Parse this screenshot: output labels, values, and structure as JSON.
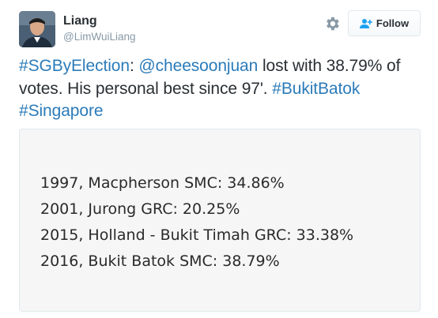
{
  "author": {
    "display_name": "Liang",
    "handle": "@LimWuiLiang"
  },
  "actions": {
    "settings_icon": "gear-icon",
    "follow_label": "Follow",
    "follow_icon": "user-plus-icon"
  },
  "tweet": {
    "hashtag_election": "#SGByElection",
    "sep1": ": ",
    "mention": "@cheesoonjuan",
    "body": " lost with 38.79% of votes. His personal best since 97'. ",
    "hashtag_bukitbatok": "#BukitBatok",
    "sep2": " ",
    "hashtag_singapore": "#Singapore"
  },
  "image": {
    "lines": [
      "1997, Macpherson SMC: 34.86%",
      "2001, Jurong GRC: 20.25%",
      "2015, Holland - Bukit Timah GRC: 33.38%",
      "2016, Bukit Batok SMC: 38.79%"
    ]
  },
  "colors": {
    "link": "#2b7bb9",
    "text": "#292f33",
    "muted": "#8899a6"
  }
}
